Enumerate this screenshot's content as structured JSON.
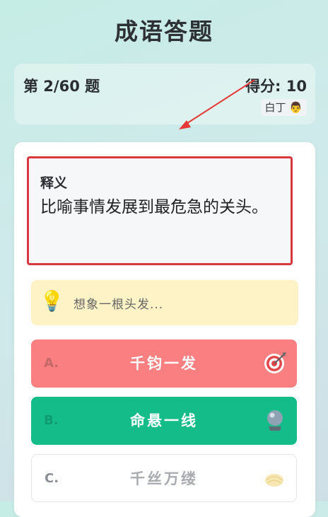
{
  "header": {
    "title": "成语答题"
  },
  "status": {
    "question_counter": "第 2/60 题",
    "score": "得分: 10",
    "rank_label": "白丁",
    "rank_emoji": "👨"
  },
  "question": {
    "definition_label": "释义",
    "definition_text": "比喻事情发展到最危急的关头。"
  },
  "hint": {
    "emoji": "💡",
    "text": "想象一根头发..."
  },
  "options": [
    {
      "letter": "A.",
      "text": "千钧一发",
      "icon": "target-icon",
      "state": "wrong"
    },
    {
      "letter": "B.",
      "text": "命悬一线",
      "icon": "crystal-ball-icon",
      "state": "correct"
    },
    {
      "letter": "C.",
      "text": "千丝万缕",
      "icon": "yarn-icon",
      "state": "neutral"
    }
  ],
  "colors": {
    "highlight_box": "#d9363e",
    "annotation_arrow": "#e53935",
    "option_wrong": "#f9696a",
    "option_correct": "#14bc8a",
    "hint_bg": "#fdf3c6"
  }
}
